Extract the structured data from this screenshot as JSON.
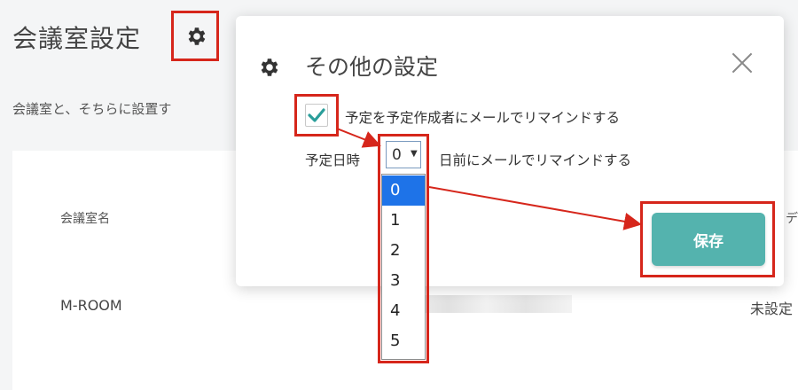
{
  "page": {
    "title": "会議室設定",
    "description": "会議室と、そちらに設置す",
    "table": {
      "col_room": "会議室名",
      "col_right": "デ",
      "rows": [
        {
          "room": "M-ROOM",
          "right": "未設定"
        }
      ]
    }
  },
  "modal": {
    "title": "その他の設定",
    "checkbox_label": "予定を予定作成者にメールでリマインドする",
    "checkbox_checked": true,
    "schedule_label": "予定日時",
    "select_value": "0",
    "after_label": "日前にメールでリマインドする",
    "options": [
      "0",
      "1",
      "2",
      "3",
      "4",
      "5"
    ],
    "selected_index": 0,
    "save_label": "保存"
  },
  "colors": {
    "highlight": "#d6261b",
    "save_button": "#54b3ae",
    "option_selected": "#1e73e8",
    "check": "#2a9e9a"
  },
  "icons": {
    "title_gear": "gear-icon",
    "modal_gear": "gear-icon",
    "close": "close-icon",
    "check": "checkmark-icon",
    "caret": "caret-down-icon"
  }
}
